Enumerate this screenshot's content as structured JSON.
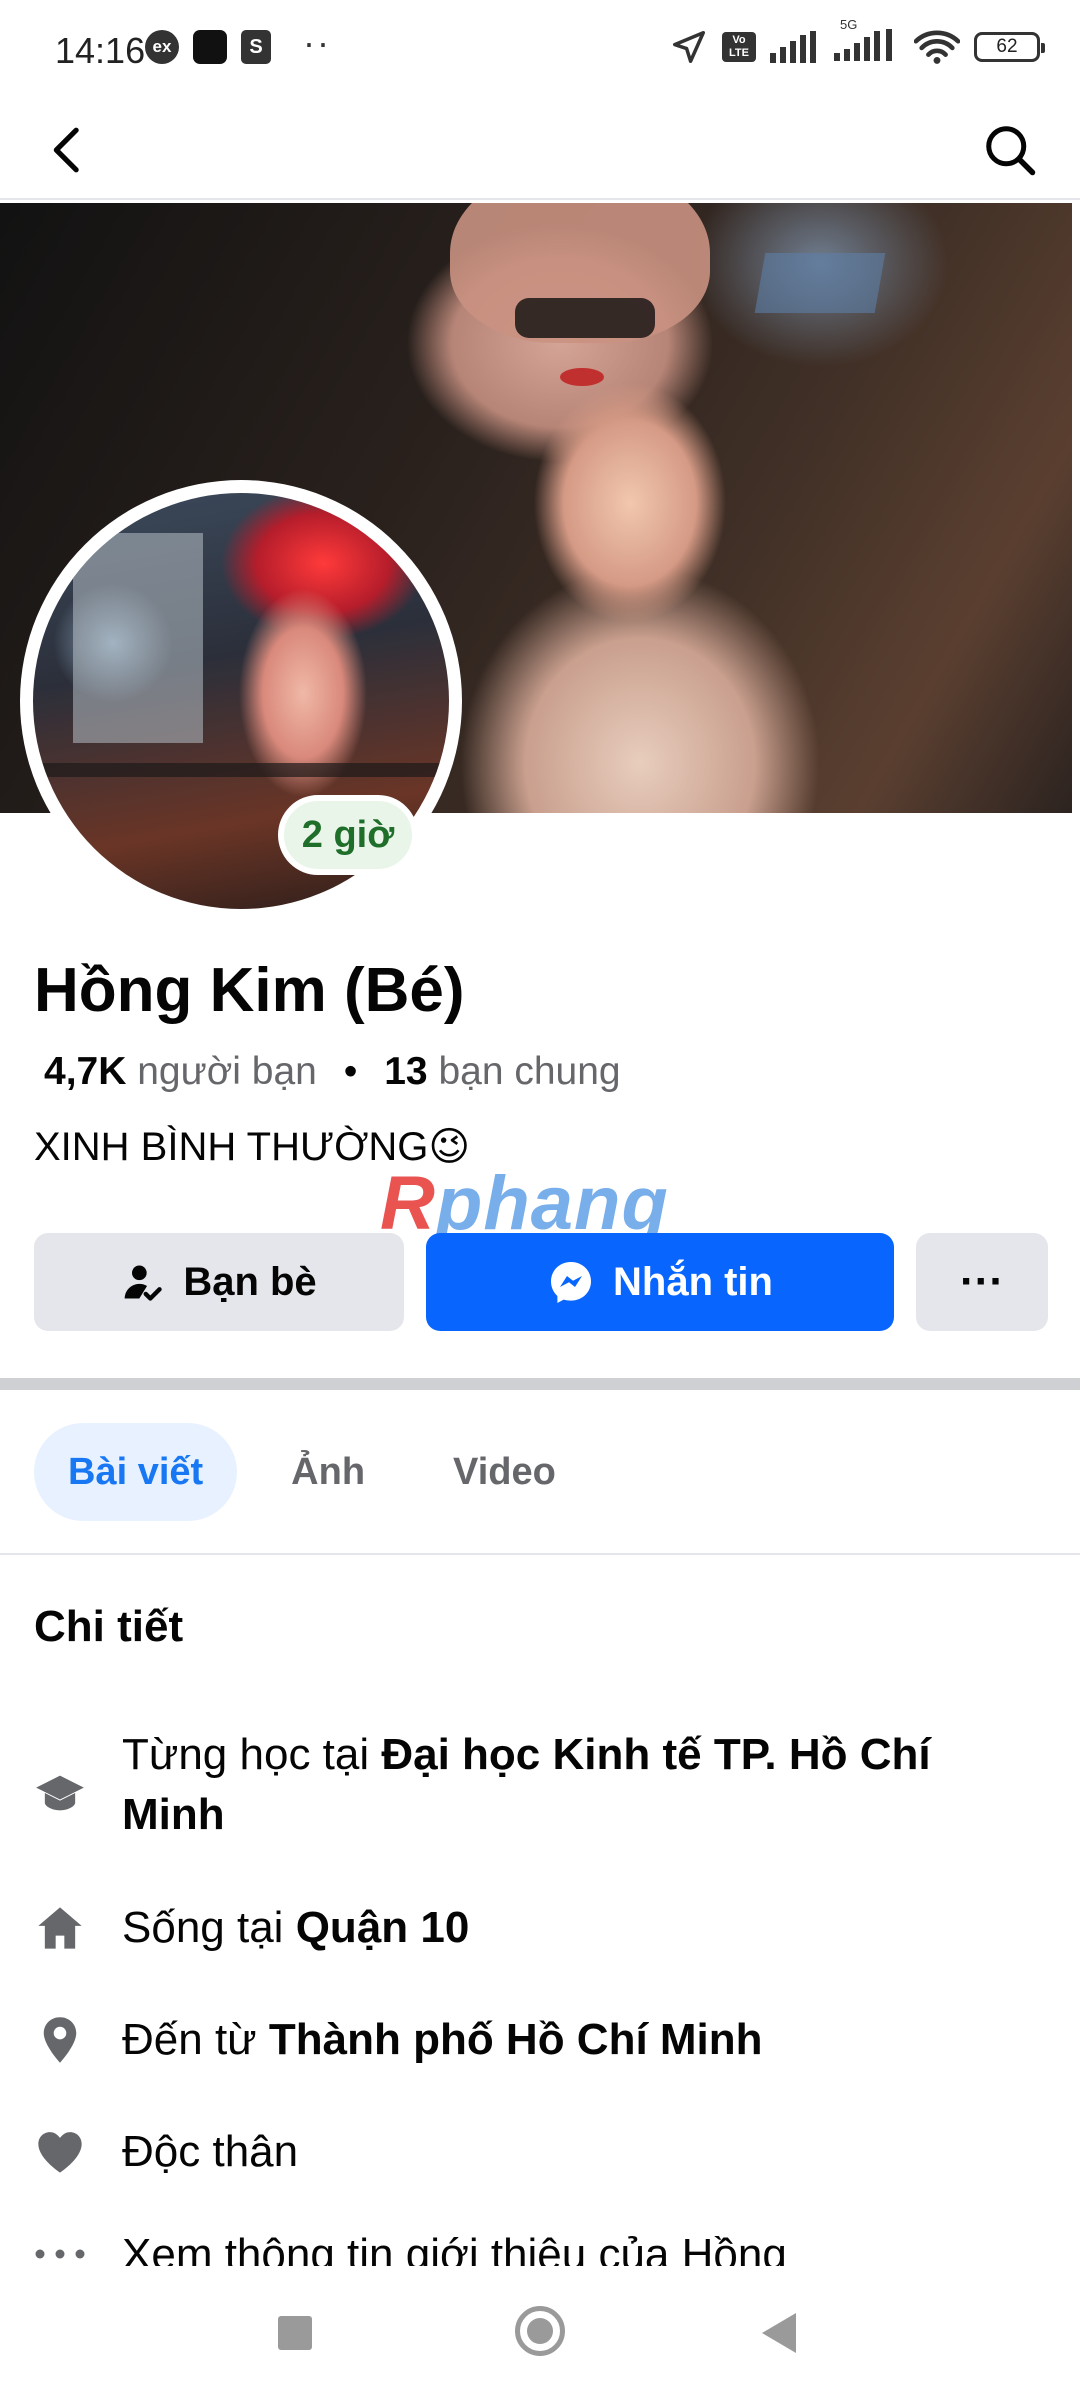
{
  "status_bar": {
    "time": "14:16",
    "ex_badge": "ex",
    "shop_badge": "S",
    "overflow_dots": "··",
    "lte_label": "Vo LTE",
    "network": "5G",
    "battery": "62"
  },
  "profile": {
    "name": "Hồng Kim (Bé)",
    "story_badge": "2 giờ",
    "friends_count": "4,7K",
    "friends_label": "người bạn",
    "separator": "•",
    "mutual_count": "13",
    "mutual_label": "bạn chung",
    "bio": "XINH BÌNH THƯỜNG😉"
  },
  "watermark": {
    "first": "R",
    "rest": "phang"
  },
  "actions": {
    "friends_label": "Bạn bè",
    "message_label": "Nhắn tin",
    "more_label": "···"
  },
  "tabs": [
    {
      "label": "Bài viết",
      "active": true
    },
    {
      "label": "Ảnh",
      "active": false
    },
    {
      "label": "Video",
      "active": false
    }
  ],
  "details": {
    "title": "Chi tiết",
    "education": {
      "prefix": "Từng học tại ",
      "value": "Đại học Kinh tế TP. Hồ Chí Minh"
    },
    "lives": {
      "prefix": "Sống tại ",
      "value": "Quận 10"
    },
    "from": {
      "prefix": "Đến từ ",
      "value": "Thành phố Hồ Chí Minh"
    },
    "relationship": {
      "value": "Độc thân"
    },
    "see_more": "Xem thông tin giới thiệu của Hồng"
  },
  "colors": {
    "accent": "#0866ff",
    "tab_active_bg": "#e7f1ff",
    "tab_active_text": "#1877f2",
    "button_grey": "#e4e6eb",
    "story_badge_text": "#1f6f2b"
  },
  "icons": {
    "back": "back-arrow-icon",
    "search": "search-icon",
    "friends": "friend-check-icon",
    "messenger": "messenger-icon",
    "education": "graduation-cap-icon",
    "home": "house-icon",
    "location": "map-pin-icon",
    "relationship": "heart-icon",
    "more": "dots-icon"
  }
}
